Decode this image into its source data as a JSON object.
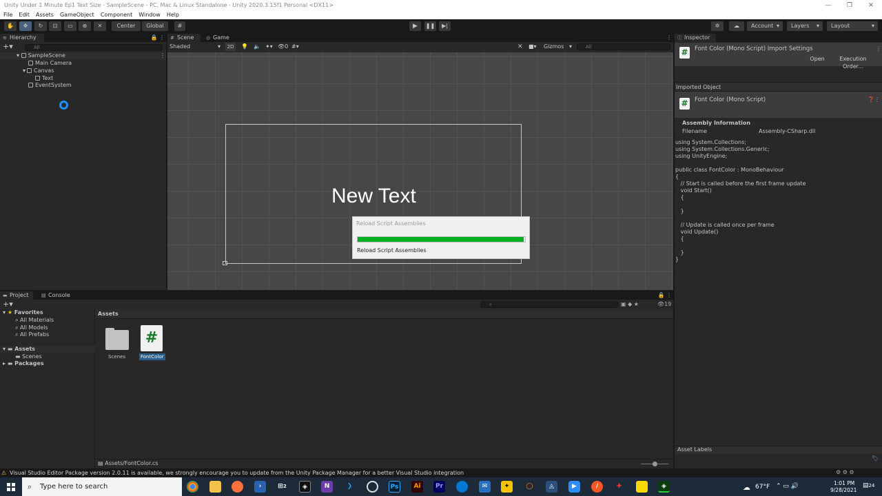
{
  "window": {
    "title": "Unity Under 1 Minute Ep1 Text Size - SampleScene - PC, Mac & Linux Standalone - Unity 2020.3.15f1 Personal <DX11>",
    "minimize": "—",
    "maximize": "❐",
    "close": "✕"
  },
  "menu": [
    "File",
    "Edit",
    "Assets",
    "GameObject",
    "Component",
    "Window",
    "Help"
  ],
  "toolbar": {
    "center_label": "Center",
    "global_label": "Global",
    "account_label": "Account",
    "layers_label": "Layers",
    "layout_label": "Layout"
  },
  "hierarchy": {
    "tab_label": "Hierarchy",
    "search_placeholder": "All",
    "items": [
      {
        "label": "SampleScene"
      },
      {
        "label": "Main Camera"
      },
      {
        "label": "Canvas"
      },
      {
        "label": "Text"
      },
      {
        "label": "EventSystem"
      }
    ]
  },
  "scene": {
    "tab_scene": "Scene",
    "tab_game": "Game",
    "shading": "Shaded",
    "mode_2d": "2D",
    "fx_count": "0",
    "gizmos": "Gizmos",
    "search_placeholder": "All",
    "text_object": "New Text"
  },
  "reload_dialog": {
    "title": "Reload Script Assemblies",
    "message": "Reload Script Assemblies",
    "progress": 0.99,
    "fill_color": "#06b025"
  },
  "inspector": {
    "tab_label": "Inspector",
    "import_title": "Font Color (Mono Script) Import Settings",
    "open_button": "Open",
    "exec_button": "Execution Order...",
    "imported_object": "Imported Object",
    "script_title": "Font Color (Mono Script)",
    "assembly_heading": "Assembly Information",
    "filename_label": "Filename",
    "filename_value": "Assembly-CSharp.dll",
    "code": "using System.Collections;\nusing System.Collections.Generic;\nusing UnityEngine;\n\npublic class FontColor : MonoBehaviour\n{\n   // Start is called before the first frame update\n   void Start()\n   {\n\n   }\n\n   // Update is called once per frame\n   void Update()\n   {\n\n   }\n}",
    "asset_labels": "Asset Labels"
  },
  "project": {
    "tab_project": "Project",
    "tab_console": "Console",
    "hidden_count": "19",
    "favorites": "Favorites",
    "fav_items": [
      "All Materials",
      "All Models",
      "All Prefabs"
    ],
    "assets": "Assets",
    "scenes": "Scenes",
    "packages": "Packages",
    "breadcrumb": "Assets",
    "tiles": [
      {
        "label": "Scenes"
      },
      {
        "label": "FontColor"
      }
    ],
    "path": "Assets/FontColor.cs"
  },
  "status": {
    "message": "Visual Studio Editor Package version 2.0.11 is available, we strongly encourage you to update from the Unity Package Manager for a better Visual Studio integration"
  },
  "taskbar": {
    "search_placeholder": "Type here to search",
    "weather": "67°F",
    "time": "1:01 PM",
    "date": "9/28/2021",
    "notif_count": "24",
    "taskview_badge": "2"
  }
}
